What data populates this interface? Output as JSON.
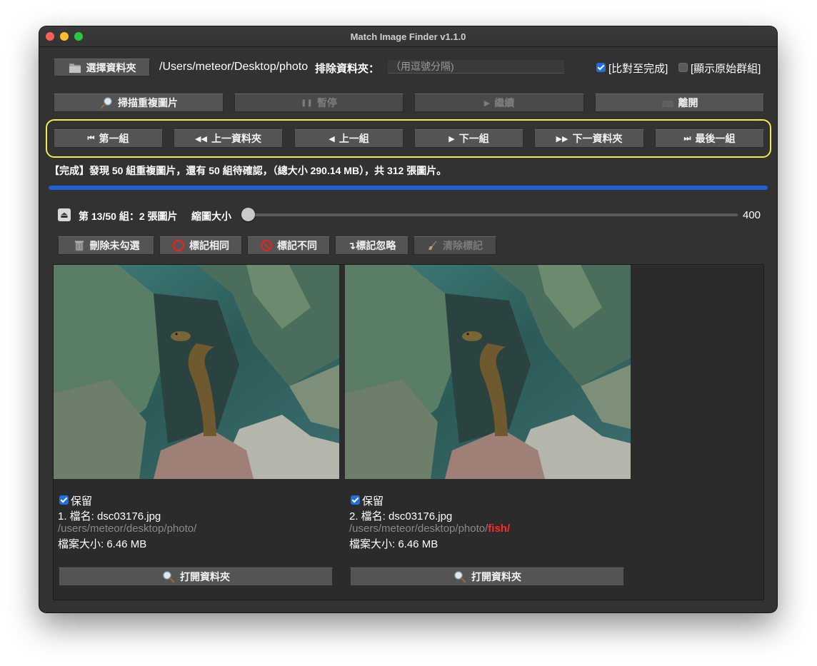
{
  "window": {
    "title": "Match Image Finder v1.1.0"
  },
  "toolbar": {
    "select_folder_label": "選擇資料夾",
    "folder_path": "/Users/meteor/Desktop/photo",
    "exclude_label": "排除資料夾：",
    "exclude_placeholder": "（用逗號分隔)",
    "compare_all_label": "[比對至完成]",
    "compare_all_checked": true,
    "show_original_group_label": "[顯示原始群組]",
    "show_original_group_checked": false
  },
  "actions": {
    "scan": "掃描重複圖片",
    "pause": "暫停",
    "resume": "繼續",
    "exit": "離開"
  },
  "navigation": {
    "first_group": "第一組",
    "prev_folder": "上一資料夾",
    "prev_group": "上一組",
    "next_group": "下一組",
    "next_folder": "下一資料夾",
    "last_group": "最後一組"
  },
  "status": {
    "message": "【完成】發現 50 組重複圖片，還有 50 組待確認，（總大小 290.14 MB），共 312 張圖片。",
    "progress_percent": 100
  },
  "group": {
    "info": "第 13/50 組：2 張圖片",
    "thumb_size_label": "縮圖大小",
    "thumb_size_value": "400",
    "thumb_size_fraction": 0.0
  },
  "mark_actions": {
    "delete_unchecked": "刪除未勾選",
    "mark_same": "標記相同",
    "mark_different": "標記不同",
    "mark_ignore": "↴標記忽略",
    "clear_marks": "清除標記"
  },
  "images": [
    {
      "keep_label": "保留",
      "keep_checked": true,
      "filename": "1. 檔名: dsc03176.jpg",
      "path": "/users/meteor/desktop/photo/",
      "path_extra": "",
      "size": "檔案大小: 6.46 MB",
      "open_folder_label": "打開資料夾"
    },
    {
      "keep_label": "保留",
      "keep_checked": true,
      "filename": "2. 檔名: dsc03176.jpg",
      "path": "/users/meteor/desktop/photo/",
      "path_extra": "fish/",
      "size": "檔案大小: 6.46 MB",
      "open_folder_label": "打開資料夾"
    }
  ],
  "colors": {
    "accent": "#1e62d6",
    "highlight_border": "#f2ec4c",
    "path_highlight": "#ff2a2a"
  }
}
